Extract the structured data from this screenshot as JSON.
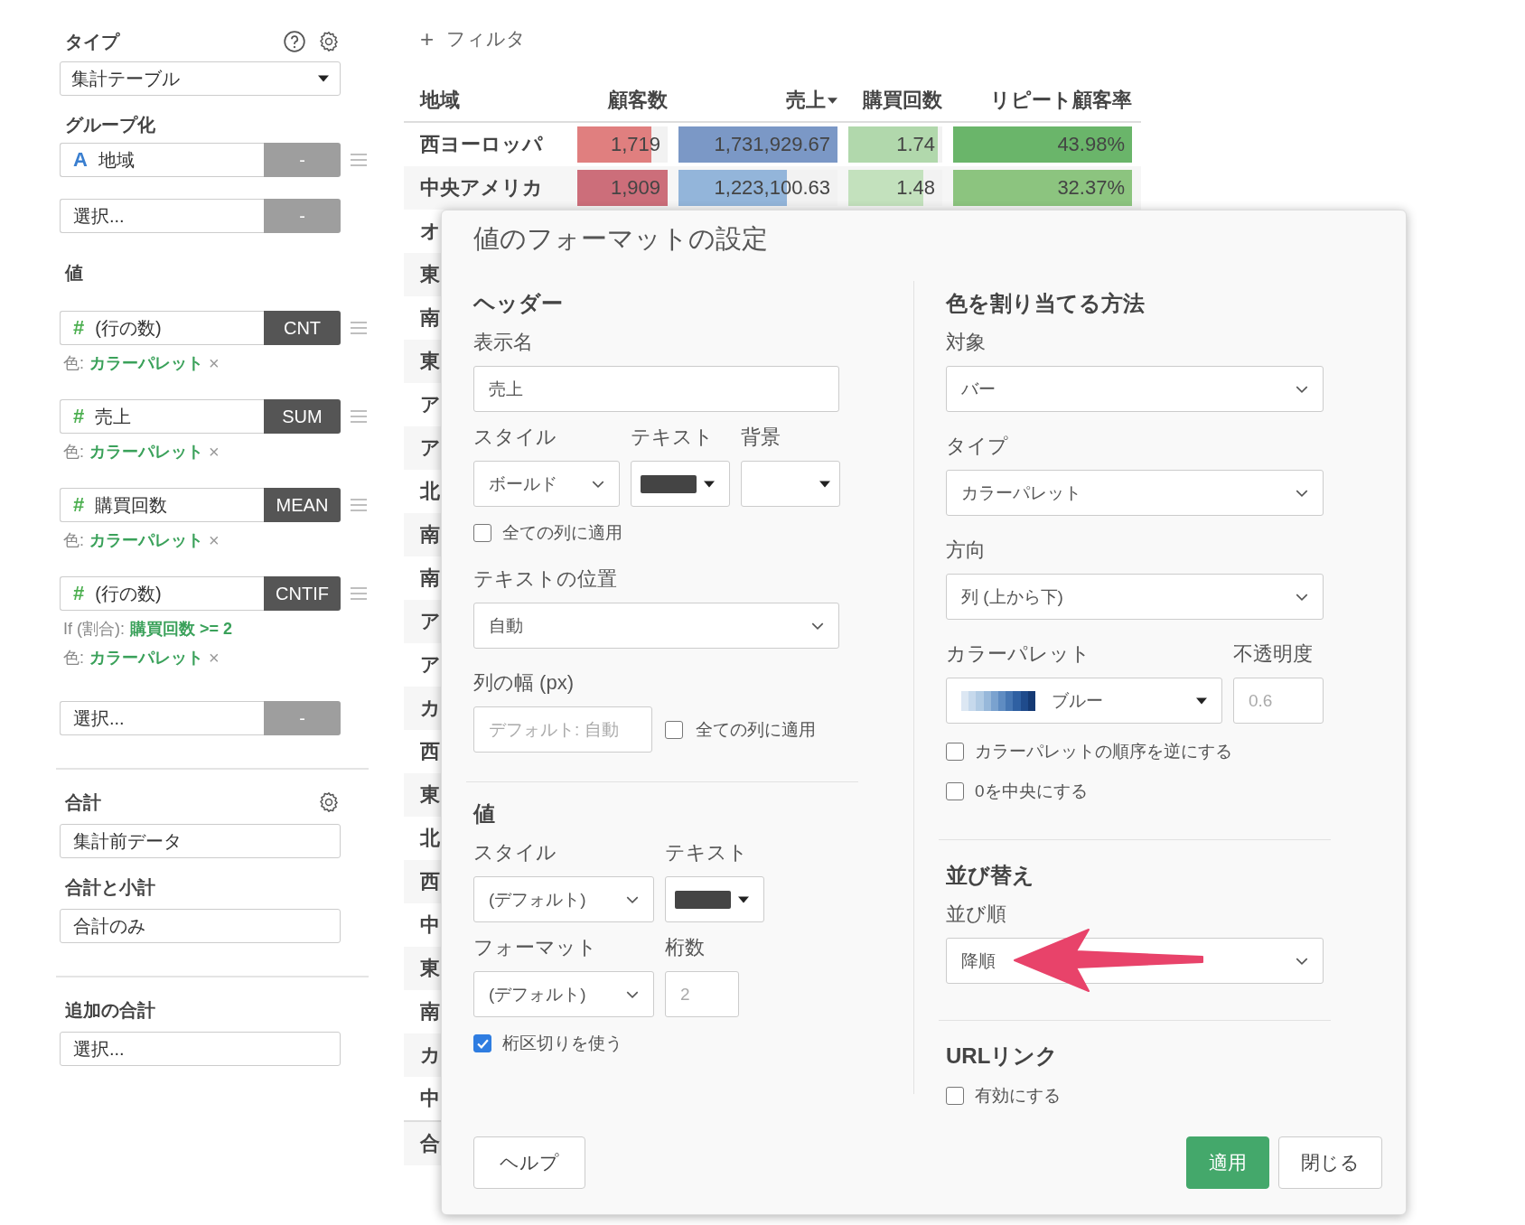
{
  "sidebar": {
    "type_label": "タイプ",
    "type_value": "集計テーブル",
    "group_label": "グループ化",
    "groups": [
      {
        "kind": "text",
        "icon": "A",
        "name": "地域",
        "agg": "-"
      }
    ],
    "group_select": {
      "value": "選択...",
      "agg": "-"
    },
    "values_label": "値",
    "values": [
      {
        "kind": "number",
        "icon": "#",
        "name": "(行の数)",
        "agg": "CNT",
        "notes": [
          {
            "label": "色:",
            "value": "カラーパレット",
            "remove": "×"
          }
        ]
      },
      {
        "kind": "number",
        "icon": "#",
        "name": "売上",
        "agg": "SUM",
        "notes": [
          {
            "label": "色:",
            "value": "カラーパレット",
            "remove": "×"
          }
        ]
      },
      {
        "kind": "number",
        "icon": "#",
        "name": "購買回数",
        "agg": "MEAN",
        "notes": [
          {
            "label": "色:",
            "value": "カラーパレット",
            "remove": "×"
          }
        ]
      },
      {
        "kind": "number",
        "icon": "#",
        "name": "(行の数)",
        "agg": "CNTIF",
        "notes": [
          {
            "label": "If (割合):",
            "value": "購買回数 >= 2"
          },
          {
            "label": "色:",
            "value": "カラーパレット",
            "remove": "×"
          }
        ]
      }
    ],
    "value_select": {
      "value": "選択...",
      "agg": "-"
    },
    "total_label": "合計",
    "total_value": "集計前データ",
    "subtotal_label": "合計と小計",
    "subtotal_value": "合計のみ",
    "extra_label": "追加の合計",
    "extra_value": "選択..."
  },
  "filter": {
    "icon": "+",
    "label": "フィルタ"
  },
  "table": {
    "columns": [
      {
        "label": "地域",
        "sorted": false
      },
      {
        "label": "顧客数",
        "sorted": false
      },
      {
        "label": "売上",
        "sorted": true
      },
      {
        "label": "購買回数",
        "sorted": false
      },
      {
        "label": "リピート顧客率",
        "sorted": false
      }
    ],
    "rows": [
      {
        "kind": "data",
        "region": "西ヨーロッパ",
        "cells": [
          {
            "text": "1,719",
            "level": 0.82,
            "color": "#e07f7f"
          },
          {
            "text": "1,731,929.67",
            "level": 1,
            "color": "#7b98c6"
          },
          {
            "text": "1.74",
            "level": 0.95,
            "color": "#b1d8ac"
          },
          {
            "text": "43.98%",
            "level": 1,
            "color": "#6ab56a"
          }
        ]
      },
      {
        "kind": "data",
        "region": "中央アメリカ",
        "cells": [
          {
            "text": "1,909",
            "level": 1,
            "color": "#cc6e7a"
          },
          {
            "text": "1,223,100.63",
            "level": 0.68,
            "color": "#93b5da"
          },
          {
            "text": "1.48",
            "level": 0.8,
            "color": "#c3e1bd"
          },
          {
            "text": "32.37%",
            "level": 1,
            "color": "#8cc47f"
          }
        ]
      },
      {
        "kind": "data",
        "region": "オ"
      },
      {
        "kind": "data",
        "region": "東"
      },
      {
        "kind": "data",
        "region": "南"
      },
      {
        "kind": "data",
        "region": "東"
      },
      {
        "kind": "data",
        "region": "ア"
      },
      {
        "kind": "data",
        "region": "ア"
      },
      {
        "kind": "data",
        "region": "北"
      },
      {
        "kind": "data",
        "region": "南"
      },
      {
        "kind": "data",
        "region": "南"
      },
      {
        "kind": "data",
        "region": "ア"
      },
      {
        "kind": "data",
        "region": "ア"
      },
      {
        "kind": "data",
        "region": "カ"
      },
      {
        "kind": "data",
        "region": "西"
      },
      {
        "kind": "data",
        "region": "東"
      },
      {
        "kind": "data",
        "region": "北"
      },
      {
        "kind": "data",
        "region": "西"
      },
      {
        "kind": "data",
        "region": "中"
      },
      {
        "kind": "data",
        "region": "東"
      },
      {
        "kind": "data",
        "region": "南"
      },
      {
        "kind": "data",
        "region": "カ"
      },
      {
        "kind": "data",
        "region": "中"
      },
      {
        "kind": "total",
        "region": "合"
      }
    ]
  },
  "dialog": {
    "title": "値のフォーマットの設定",
    "header": {
      "title": "ヘッダー",
      "name_label": "表示名",
      "name_value": "売上",
      "style_label": "スタイル",
      "style_value": "ボールド",
      "text_label": "テキスト",
      "bg_label": "背景",
      "apply_all": {
        "label": "全ての列に適用",
        "checked": false
      },
      "position_label": "テキストの位置",
      "position_value": "自動",
      "width_label": "列の幅 (px)",
      "width_placeholder": "デフォルト: 自動",
      "width_apply_all": {
        "label": "全ての列に適用",
        "checked": false
      }
    },
    "values": {
      "title": "値",
      "style_label": "スタイル",
      "style_value": "(デフォルト)",
      "text_label": "テキスト",
      "format_label": "フォーマット",
      "format_value": "(デフォルト)",
      "digits_label": "桁数",
      "digits_placeholder": "2",
      "separator": {
        "label": "桁区切りを使う",
        "checked": true
      }
    },
    "color": {
      "title": "色を割り当てる方法",
      "target_label": "対象",
      "target_value": "バー",
      "type_label": "タイプ",
      "type_value": "カラーパレット",
      "direction_label": "方向",
      "direction_value": "列 (上から下)",
      "palette_label": "カラーパレット",
      "palette_value": "ブルー",
      "opacity_label": "不透明度",
      "opacity_placeholder": "0.6",
      "options": [
        {
          "label": "カラーパレットの順序を逆にする",
          "checked": false
        },
        {
          "label": "0を中央にする",
          "checked": false
        }
      ]
    },
    "sort": {
      "title": "並び替え",
      "order_label": "並び順",
      "order_value": "降順"
    },
    "url": {
      "title": "URLリンク",
      "enable": {
        "label": "有効にする",
        "checked": false
      }
    },
    "buttons": [
      {
        "label": "ヘルプ",
        "kind": "default"
      },
      {
        "label": "適用",
        "kind": "primary"
      },
      {
        "label": "閉じる",
        "kind": "default"
      }
    ]
  }
}
